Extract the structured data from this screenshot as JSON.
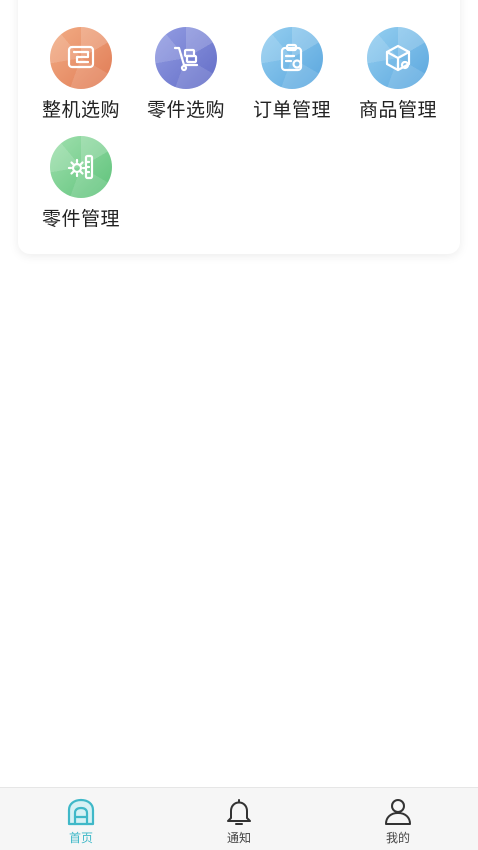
{
  "shortcuts": [
    {
      "label": "整机选购",
      "icon": "sewing-machine-icon",
      "color_from": "#f0a37a",
      "color_to": "#e07d57"
    },
    {
      "label": "零件选购",
      "icon": "hand-truck-icon",
      "color_from": "#8d96e0",
      "color_to": "#6670c9"
    },
    {
      "label": "订单管理",
      "icon": "clipboard-icon",
      "color_from": "#8cc9ee",
      "color_to": "#5aa8e0"
    },
    {
      "label": "商品管理",
      "icon": "box-icon",
      "color_from": "#8cc9ee",
      "color_to": "#5aa8e0"
    },
    {
      "label": "零件管理",
      "icon": "gear-parts-icon",
      "color_from": "#98dca6",
      "color_to": "#5ec27a"
    }
  ],
  "tabbar": {
    "tabs": [
      {
        "label": "首页",
        "icon": "home-icon",
        "active": true
      },
      {
        "label": "通知",
        "icon": "bell-icon",
        "active": false
      },
      {
        "label": "我的",
        "icon": "user-icon",
        "active": false
      }
    ],
    "active_color": "#3fb8c8",
    "inactive_color": "#444444"
  }
}
